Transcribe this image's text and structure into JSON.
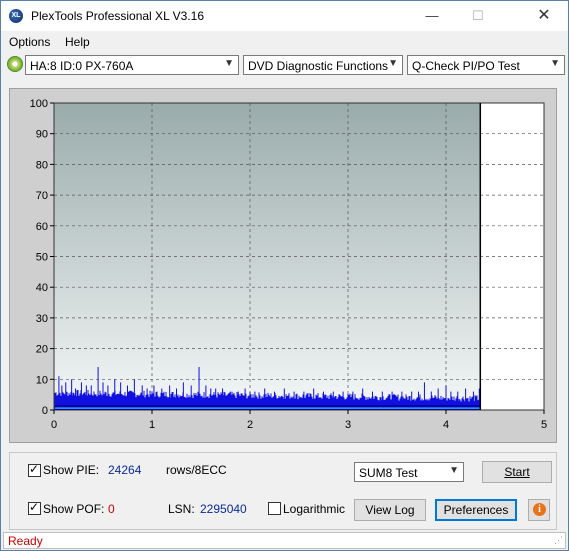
{
  "window": {
    "title": "PlexTools Professional XL V3.16",
    "icon_text": "XL"
  },
  "menu": {
    "items": [
      "Options",
      "Help"
    ]
  },
  "toolbar": {
    "drive": "HA:8 ID:0  PX-760A",
    "functions": "DVD Diagnostic Functions",
    "test": "Q-Check PI/PO Test"
  },
  "chart_data": {
    "type": "bar",
    "x": [
      0,
      4.35
    ],
    "xlim": [
      0,
      5
    ],
    "ylim": [
      0,
      100
    ],
    "xticks": [
      "0",
      "1",
      "2",
      "3",
      "4",
      "5"
    ],
    "yticks": [
      "0",
      "10",
      "20",
      "30",
      "40",
      "50",
      "60",
      "70",
      "80",
      "90",
      "100"
    ],
    "data_end_x": 4.35,
    "grid": true,
    "colors": {
      "pie": "#1010e0",
      "pie_sum": "#0000aa",
      "baseline": "#35a8e8",
      "end_marker": "#000000"
    },
    "spikes": [
      [
        0.05,
        11
      ],
      [
        0.08,
        8
      ],
      [
        0.12,
        9
      ],
      [
        0.18,
        10
      ],
      [
        0.22,
        7
      ],
      [
        0.28,
        9
      ],
      [
        0.33,
        8
      ],
      [
        0.38,
        8
      ],
      [
        0.45,
        14
      ],
      [
        0.5,
        9
      ],
      [
        0.55,
        8
      ],
      [
        0.62,
        10
      ],
      [
        0.68,
        9
      ],
      [
        0.75,
        8
      ],
      [
        0.82,
        10
      ],
      [
        0.9,
        8
      ],
      [
        0.95,
        7
      ],
      [
        1.02,
        8
      ],
      [
        1.1,
        7
      ],
      [
        1.18,
        8
      ],
      [
        1.25,
        7
      ],
      [
        1.32,
        9
      ],
      [
        1.4,
        8
      ],
      [
        1.48,
        14
      ],
      [
        1.55,
        8
      ],
      [
        1.6,
        7
      ],
      [
        1.65,
        7
      ],
      [
        1.72,
        7
      ],
      [
        1.8,
        6
      ],
      [
        1.88,
        6
      ],
      [
        1.95,
        7
      ],
      [
        2.05,
        6
      ],
      [
        2.15,
        7
      ],
      [
        2.25,
        6
      ],
      [
        2.35,
        7
      ],
      [
        2.45,
        6
      ],
      [
        2.55,
        6
      ],
      [
        2.65,
        7
      ],
      [
        2.75,
        6
      ],
      [
        2.85,
        6
      ],
      [
        2.95,
        6
      ],
      [
        3.05,
        6
      ],
      [
        3.15,
        7
      ],
      [
        3.25,
        6
      ],
      [
        3.35,
        6
      ],
      [
        3.45,
        6
      ],
      [
        3.55,
        6
      ],
      [
        3.65,
        6
      ],
      [
        3.72,
        6
      ],
      [
        3.78,
        9
      ],
      [
        3.85,
        6
      ],
      [
        3.92,
        7
      ],
      [
        4.0,
        8
      ],
      [
        4.05,
        6
      ],
      [
        4.12,
        6
      ],
      [
        4.2,
        7
      ],
      [
        4.28,
        6
      ],
      [
        4.34,
        7
      ]
    ]
  },
  "panel": {
    "show_pie_label": "Show PIE:",
    "pie_value": "24264",
    "pie_unit": "rows/8ECC",
    "show_pof_label": "Show POF:",
    "pof_value": "0",
    "lsn_label": "LSN:",
    "lsn_value": "2295040",
    "logarithmic_label": "Logarithmic",
    "test_select": "SUM8 Test",
    "start_label": "Start",
    "view_log_label": "View Log",
    "preferences_label": "Preferences"
  },
  "status": {
    "text": "Ready"
  }
}
